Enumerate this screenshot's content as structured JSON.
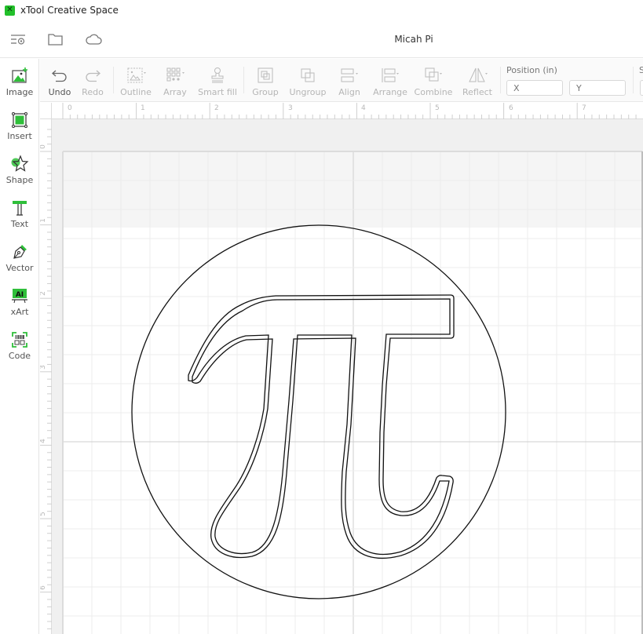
{
  "window": {
    "title": "xTool Creative Space",
    "app_icon": "xtool-logo-icon"
  },
  "topbar": {
    "icons": [
      "menu-settings-icon",
      "folder-icon",
      "cloud-icon"
    ],
    "document_title": "Micah Pi"
  },
  "sidebar": {
    "items": [
      {
        "label": "Image",
        "icon": "image-icon"
      },
      {
        "label": "Insert",
        "icon": "insert-icon"
      },
      {
        "label": "Shape",
        "icon": "shape-icon"
      },
      {
        "label": "Text",
        "icon": "text-icon"
      },
      {
        "label": "Vector",
        "icon": "pen-icon"
      },
      {
        "label": "xArt",
        "icon": "ai-icon"
      },
      {
        "label": "Code",
        "icon": "qr-code-icon"
      }
    ],
    "accent_color": "#2fbf3a"
  },
  "toolbar": {
    "undo": "Undo",
    "redo": "Redo",
    "outline": "Outline",
    "array": "Array",
    "smart_fill": "Smart fill",
    "group": "Group",
    "ungroup": "Ungroup",
    "align": "Align",
    "arrange": "Arrange",
    "combine": "Combine",
    "reflect": "Reflect",
    "position": {
      "label": "Position (in)",
      "x_placeholder": "X",
      "y_placeholder": "Y"
    },
    "size_label_partial": "S"
  },
  "rulers": {
    "unit": "in",
    "horizontal_labels": [
      "0",
      "1",
      "2",
      "3",
      "4",
      "5",
      "6",
      "7"
    ],
    "vertical_labels": [
      "0",
      "1",
      "2",
      "3",
      "4",
      "5",
      "6"
    ]
  },
  "canvas": {
    "objects": [
      {
        "type": "circle",
        "name": "circle-outline"
      },
      {
        "type": "path",
        "name": "pi-symbol-outer-outline"
      },
      {
        "type": "path",
        "name": "pi-symbol-inner-outline"
      }
    ]
  }
}
